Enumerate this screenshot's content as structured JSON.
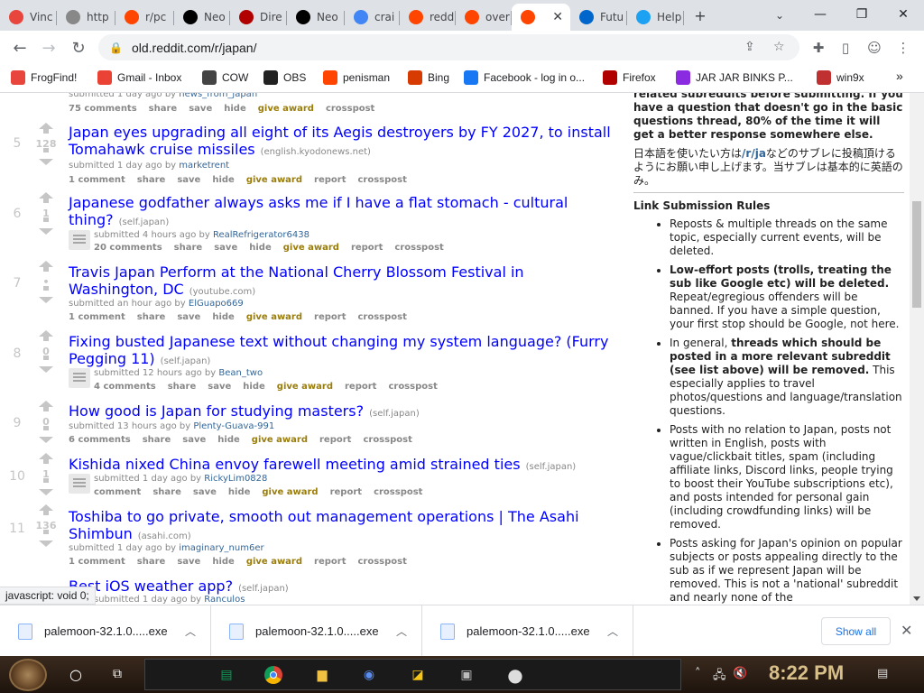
{
  "browser": {
    "tabs": [
      {
        "title": "Vinc",
        "color": "#e8453c",
        "icon": "vinted-icon"
      },
      {
        "title": "http",
        "color": "#888888",
        "icon": "page-icon"
      },
      {
        "title": "r/pc",
        "color": "#ff4500",
        "icon": "reddit-icon"
      },
      {
        "title": "Neo",
        "color": "#000000",
        "icon": "star-icon"
      },
      {
        "title": "Dire",
        "color": "#b00000",
        "icon": "dragon-icon"
      },
      {
        "title": "Neo",
        "color": "#000000",
        "icon": "star-icon"
      },
      {
        "title": "crai",
        "color": "#4285f4",
        "icon": "google-icon"
      },
      {
        "title": "redd",
        "color": "#ff4500",
        "icon": "reddit-icon"
      },
      {
        "title": "over",
        "color": "#ff4500",
        "icon": "reddit-icon"
      },
      {
        "title": "",
        "color": "#ff4500",
        "icon": "reddit-icon",
        "active": true
      },
      {
        "title": "Futu",
        "color": "#0066cc",
        "icon": "mf-icon"
      },
      {
        "title": "Help",
        "color": "#1da1f2",
        "icon": "twitter-icon"
      }
    ],
    "new_tab": "+",
    "url": "old.reddit.com/r/japan/",
    "bookmarks": [
      {
        "label": "FrogFind!",
        "color": "#e8453c"
      },
      {
        "label": "Gmail - Inbox",
        "color": "#ea4335"
      },
      {
        "label": "COW",
        "color": "#444444"
      },
      {
        "label": "OBS",
        "color": "#222222"
      },
      {
        "label": "penisman",
        "color": "#ff4500"
      },
      {
        "label": "Bing",
        "color": "#d83b01"
      },
      {
        "label": "Facebook - log in o...",
        "color": "#1877f2"
      },
      {
        "label": "Firefox",
        "color": "#b00000"
      },
      {
        "label": "JAR JAR BINKS P...",
        "color": "#8a2be2"
      },
      {
        "label": "win9x",
        "color": "#c03030"
      }
    ],
    "bookmarks_overflow": "»",
    "status_text": "javascript: void 0;"
  },
  "posts": [
    {
      "tagline_prefix": "submitted 1 day ago by",
      "author": "news_from_japan",
      "buttons": [
        "75 comments",
        "share",
        "save",
        "hide",
        "give award",
        "crosspost"
      ]
    },
    {
      "rank": "5",
      "score": "128",
      "title": "Japan eyes upgrading all eight of its Aegis destroyers by FY 2027, to install Tomahawk cruise missiles",
      "domain": "(english.kyodonews.net)",
      "tagline_prefix": "submitted 1 day ago by",
      "author": "marketrent",
      "buttons": [
        "1 comment",
        "share",
        "save",
        "hide",
        "give award",
        "report",
        "crosspost"
      ]
    },
    {
      "rank": "6",
      "score": "1",
      "title": "Japanese godfather always asks me if I have a flat stomach - cultural thing?",
      "domain": "(self.japan)",
      "tagline_prefix": "submitted 4 hours ago by",
      "author": "RealRefrigerator6438",
      "buttons": [
        "20 comments",
        "share",
        "save",
        "hide",
        "give award",
        "report",
        "crosspost"
      ]
    },
    {
      "rank": "7",
      "score": "•",
      "title": "Travis Japan Perform at the National Cherry Blossom Festival in Washington, DC",
      "domain": "(youtube.com)",
      "tagline_prefix": "submitted an hour ago by",
      "author": "ElGuapo669",
      "buttons": [
        "1 comment",
        "share",
        "save",
        "hide",
        "give award",
        "report",
        "crosspost"
      ]
    },
    {
      "rank": "8",
      "score": "0",
      "title": "Fixing busted Japanese text without changing my system language? (Furry Pegging 11)",
      "domain": "(self.japan)",
      "tagline_prefix": "submitted 12 hours ago by",
      "author": "Bean_two",
      "buttons": [
        "4 comments",
        "share",
        "save",
        "hide",
        "give award",
        "report",
        "crosspost"
      ]
    },
    {
      "rank": "9",
      "score": "0",
      "title": "How good is Japan for studying masters?",
      "domain": "(self.japan)",
      "tagline_prefix": "submitted 13 hours ago by",
      "author": "Plenty-Guava-991",
      "buttons": [
        "6 comments",
        "share",
        "save",
        "hide",
        "give award",
        "report",
        "crosspost"
      ]
    },
    {
      "rank": "10",
      "score": "1",
      "title": "Kishida nixed China envoy farewell meeting amid strained ties",
      "domain": "(self.japan)",
      "tagline_prefix": "submitted 1 day ago by",
      "author": "RickyLim0828",
      "buttons": [
        "comment",
        "share",
        "save",
        "hide",
        "give award",
        "report",
        "crosspost"
      ]
    },
    {
      "rank": "11",
      "score": "136",
      "title": "Toshiba to go private, smooth out management operations | The Asahi Shimbun",
      "domain": "(asahi.com)",
      "tagline_prefix": "submitted 1 day ago by",
      "author": "imaginary_num6er",
      "buttons": [
        "1 comment",
        "share",
        "save",
        "hide",
        "give award",
        "report",
        "crosspost"
      ]
    },
    {
      "title": "Best iOS weather app?",
      "domain": "(self.japan)",
      "tagline_prefix": "submitted 1 day ago by",
      "author": "Ranculos"
    }
  ],
  "sidebar": {
    "top_text": "related subreddits before submitting. If you have a question that doesn't go in the basic questions thread, 80% of the time it will get a better response somewhere else.",
    "jp_text_1": "日本語を使いたい方は",
    "jp_sub": "/r/ja",
    "jp_text_2": "などのサブレに投稿頂けるようにお願い申し上げます。当サブレは基本的に英語のみ。",
    "rules_title": "Link Submission Rules",
    "rules": [
      {
        "bold": "",
        "text": "Reposts & multiple threads on the same topic, especially current events, will be deleted."
      },
      {
        "bold": "Low-effort posts (trolls, treating the sub like Google etc) will be deleted.",
        "text": " Repeat/egregious offenders will be banned. If you have a simple question, your first stop should be Google, not here."
      },
      {
        "pre": "In general, ",
        "bold": "threads which should be posted in a more relevant subreddit (see list above) will be removed.",
        "text": " This especially applies to travel photos/questions and language/translation questions."
      },
      {
        "bold": "",
        "text": "Posts with no relation to Japan, posts not written in English, posts with vague/clickbait titles, spam (including affiliate links, Discord links, people trying to boost their YouTube subscriptions etc), and posts intended for personal gain (including crowdfunding links) will be removed."
      },
      {
        "bold": "",
        "text": "Posts asking for Japan's opinion on popular subjects or posts appealing directly to the sub as if we represent Japan will be removed. This is not a 'national' subreddit and nearly none of the"
      }
    ]
  },
  "downloads": {
    "items": [
      "palemoon-32.1.0.....exe",
      "palemoon-32.1.0.....exe",
      "palemoon-32.1.0.....exe"
    ],
    "show_all": "Show all"
  },
  "taskbar": {
    "clock": "8:22 PM"
  }
}
